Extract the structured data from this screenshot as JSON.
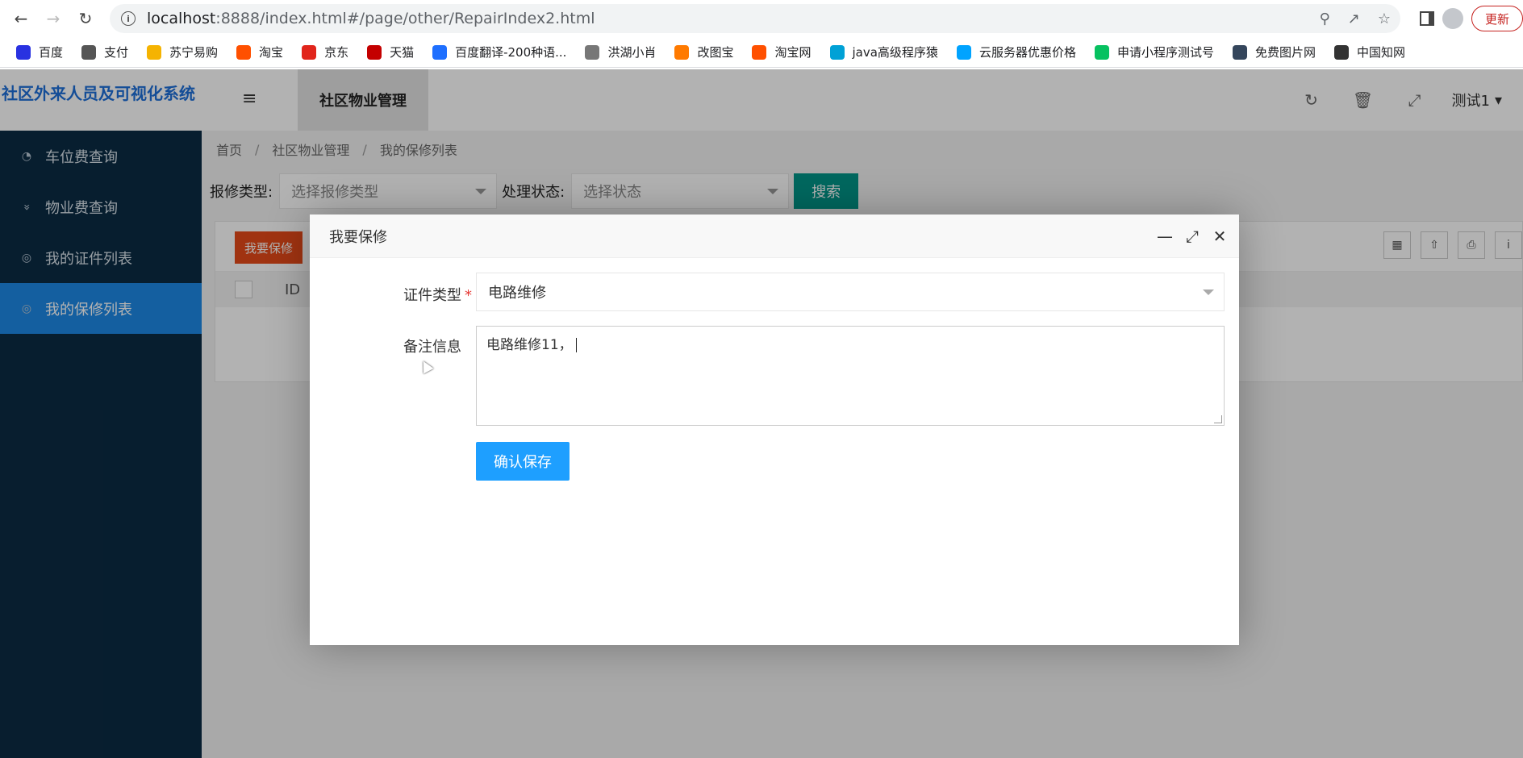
{
  "browser": {
    "url_host": "localhost",
    "url_path": ":8888/index.html#/page/other/RepairIndex2.html",
    "update_label": "更新",
    "bookmarks": [
      {
        "label": "百度",
        "icon": "baidu-icon",
        "color": "#2932e1"
      },
      {
        "label": "支付",
        "icon": "globe-icon",
        "color": "#555555"
      },
      {
        "label": "苏宁易购",
        "icon": "suning-icon",
        "color": "#f5b301"
      },
      {
        "label": "淘宝",
        "icon": "taobao-icon",
        "color": "#ff5000"
      },
      {
        "label": "京东",
        "icon": "jd-icon",
        "color": "#e1251b"
      },
      {
        "label": "天猫",
        "icon": "tmall-icon",
        "color": "#c40000"
      },
      {
        "label": "百度翻译-200种语...",
        "icon": "translate-icon",
        "color": "#1e6fff"
      },
      {
        "label": "洪湖小肖",
        "icon": "bird-icon",
        "color": "#777777"
      },
      {
        "label": "改图宝",
        "icon": "gaitubao-icon",
        "color": "#ff7a00"
      },
      {
        "label": "淘宝网",
        "icon": "taobao-icon",
        "color": "#ff5000"
      },
      {
        "label": "java高级程序猿",
        "icon": "bilibili-icon",
        "color": "#00a1d6"
      },
      {
        "label": "云服务器优惠价格",
        "icon": "cloud-icon",
        "color": "#00a3ff"
      },
      {
        "label": "申请小程序测试号",
        "icon": "wechat-icon",
        "color": "#07c160"
      },
      {
        "label": "免费图片网",
        "icon": "tumblr-icon",
        "color": "#35465c"
      },
      {
        "label": "中国知网",
        "icon": "cnki-icon",
        "color": "#333333"
      }
    ]
  },
  "app": {
    "logo": "社区外来人员及可视化系统",
    "header_tab": "社区物业管理",
    "user": "测试1"
  },
  "sidebar": {
    "items": [
      {
        "label": "车位费查询",
        "icon": "dashboard-icon"
      },
      {
        "label": "物业费查询",
        "icon": "chevron-down-icon"
      },
      {
        "label": "我的证件列表",
        "icon": "circle-icon"
      },
      {
        "label": "我的保修列表",
        "icon": "circle-icon"
      }
    ]
  },
  "breadcrumb": [
    "首页",
    "社区物业管理",
    "我的保修列表"
  ],
  "filters": {
    "type_label": "报修类型:",
    "type_placeholder": "选择报修类型",
    "status_label": "处理状态:",
    "status_placeholder": "选择状态",
    "search_label": "搜索"
  },
  "table": {
    "add_button": "我要保修",
    "columns": [
      "ID"
    ]
  },
  "dialog": {
    "title": "我要保修",
    "cert_type_label": "证件类型",
    "cert_type_value": "电路维修",
    "remark_label": "备注信息",
    "remark_value": "电路维修11，",
    "save_label": "确认保存"
  },
  "colors": {
    "sidebar_bg": "#0b2b44",
    "active": "#1e88e5",
    "search_btn": "#009688",
    "add_btn": "#e64a19",
    "save_btn": "#1e9fff"
  }
}
